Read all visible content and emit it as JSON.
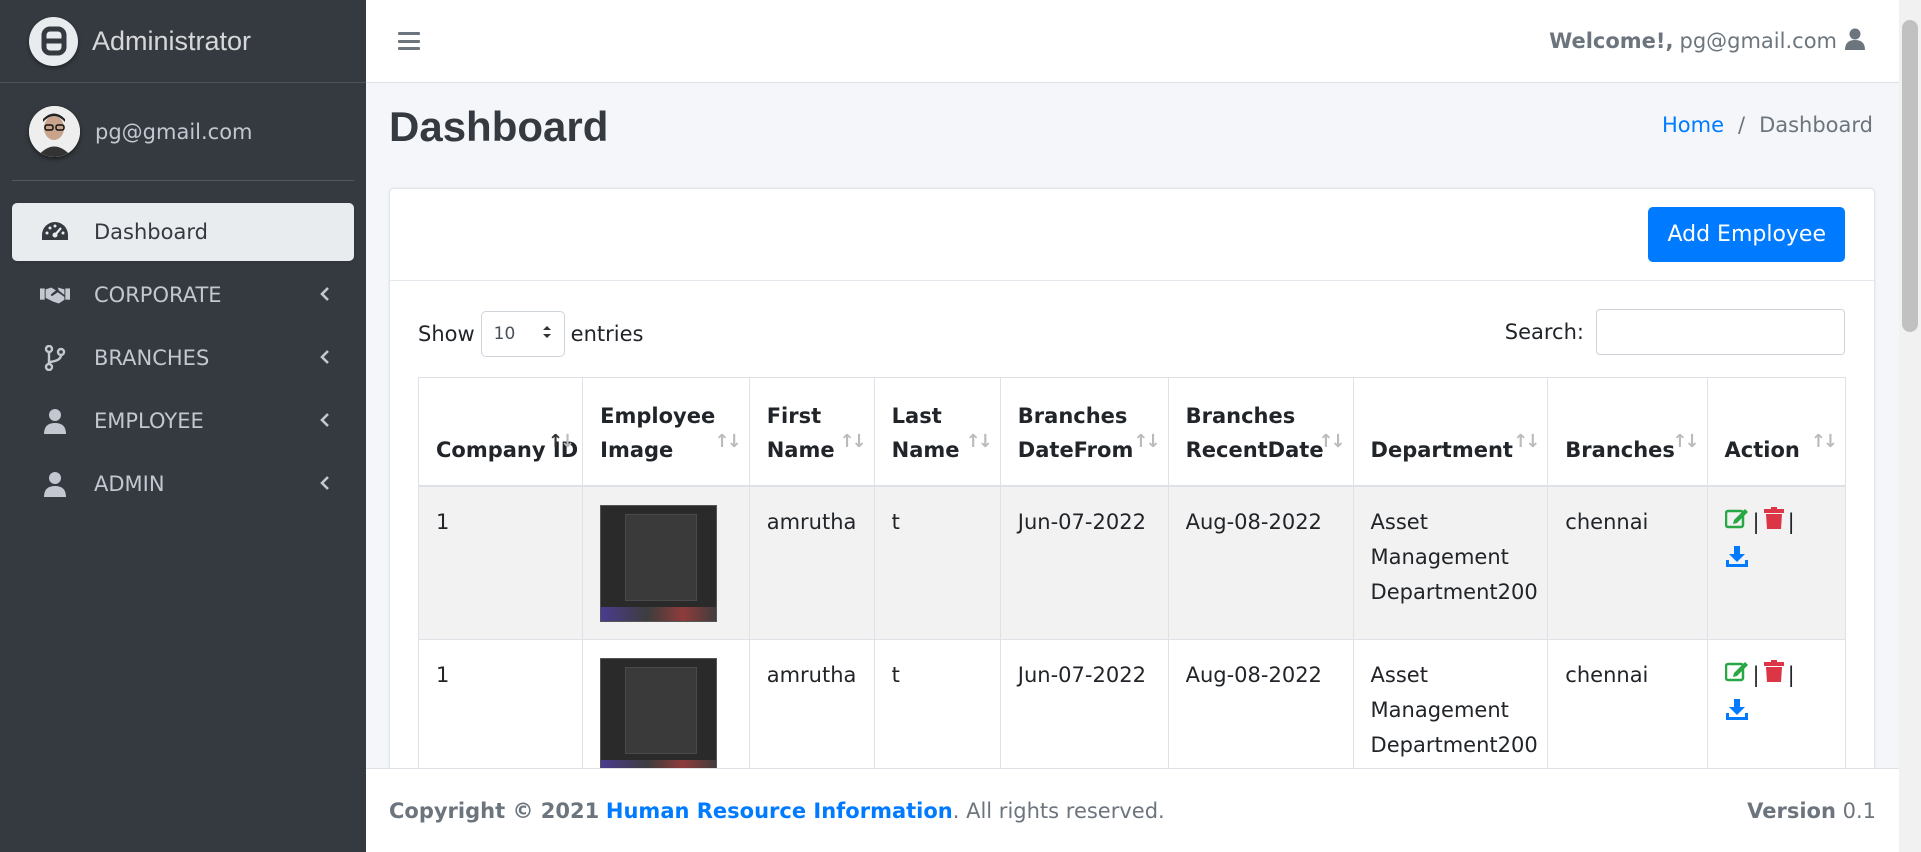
{
  "brand": {
    "name": "Administrator"
  },
  "user": {
    "email": "pg@gmail.com"
  },
  "sidebar": {
    "items": [
      {
        "label": "Dashboard",
        "icon": "tachometer-icon",
        "active": true
      },
      {
        "label": "CORPORATE",
        "icon": "handshake-icon",
        "active": false
      },
      {
        "label": "BRANCHES",
        "icon": "code-branch-icon",
        "active": false
      },
      {
        "label": "EMPLOYEE",
        "icon": "user-icon",
        "active": false
      },
      {
        "label": "ADMIN",
        "icon": "user-icon",
        "active": false
      }
    ]
  },
  "navbar": {
    "welcome_label": "Welcome!,",
    "welcome_user": "pg@gmail.com"
  },
  "page": {
    "title": "Dashboard"
  },
  "breadcrumb": {
    "home": "Home",
    "separator": "/",
    "current": "Dashboard"
  },
  "card": {
    "add_button": "Add Employee",
    "show_label": "Show",
    "entries_value": "10",
    "entries_label": "entries",
    "search_label": "Search:",
    "search_value": ""
  },
  "table": {
    "columns": [
      "Company ID",
      "Employee Image",
      "First Name",
      "Last Name",
      "Branches DateFrom",
      "Branches RecentDate",
      "Department",
      "Branches",
      "Action"
    ],
    "rows": [
      {
        "company_id": "1",
        "first_name": "amrutha",
        "last_name": "t",
        "date_from": "Jun-07-2022",
        "recent_date": "Aug-08-2022",
        "department": "Asset Management Department200",
        "branches": "chennai"
      },
      {
        "company_id": "1",
        "first_name": "amrutha",
        "last_name": "t",
        "date_from": "Jun-07-2022",
        "recent_date": "Aug-08-2022",
        "department": "Asset Management Department200",
        "branches": "chennai"
      }
    ],
    "action_separator": "|"
  },
  "footer": {
    "copyright": "Copyright © 2021",
    "org": "Human Resource Information",
    "rights": ". All rights reserved.",
    "version_label": "Version",
    "version": "0.1"
  },
  "colors": {
    "sidebar": "#343a40",
    "primary": "#007bff",
    "edit": "#28a745",
    "delete": "#dc3545"
  }
}
